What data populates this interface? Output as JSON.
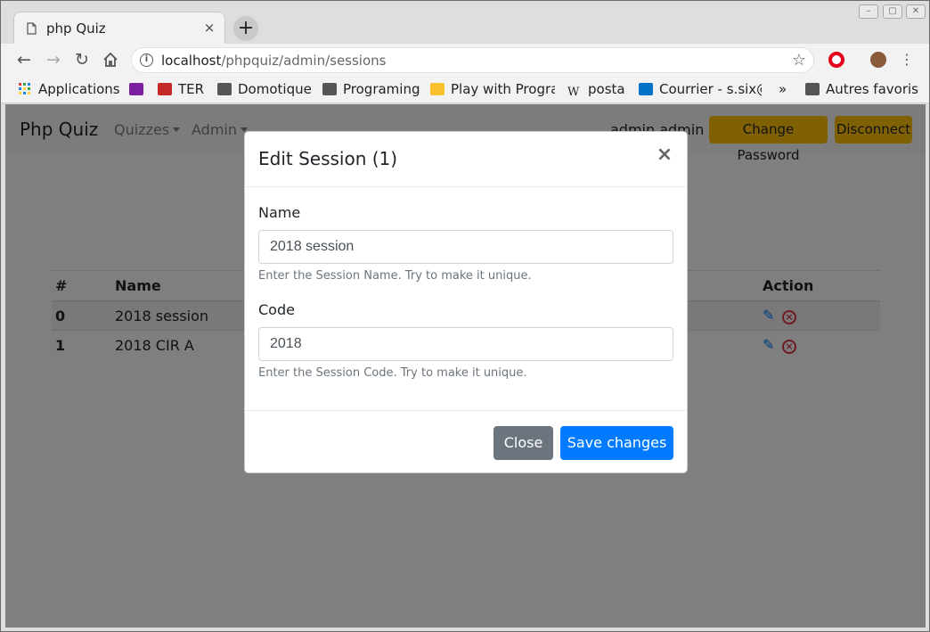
{
  "browser": {
    "tab_title": "php Quiz",
    "tab_close": "×",
    "new_tab": "+",
    "url_host": "localhost",
    "url_path": "/phpquiz/admin/sessions",
    "bookmarks": [
      "Applications",
      "TER",
      "Domotique",
      "Programing",
      "Play with Progra",
      "posta",
      "Courrier - s.six@",
      "Autres favoris"
    ],
    "overflow": "»"
  },
  "navbar": {
    "brand": "Php Quiz",
    "menu": [
      "Quizzes",
      "Admin"
    ],
    "user": "admin  admin",
    "change_password": "Change Password",
    "disconnect": "Disconnect"
  },
  "table": {
    "headers": [
      "#",
      "Name",
      "Action"
    ],
    "rows": [
      {
        "id": "0",
        "name": "2018 session"
      },
      {
        "id": "1",
        "name": "2018 CIR A"
      }
    ]
  },
  "modal": {
    "title": "Edit Session (1)",
    "close_symbol": "×",
    "name_label": "Name",
    "name_value": "2018 session",
    "name_help": "Enter the Session Name. Try to make it unique.",
    "code_label": "Code",
    "code_value": "2018",
    "code_help": "Enter the Session Code. Try to make it unique.",
    "close_button": "Close",
    "save_button": "Save changes"
  },
  "colors": {
    "primary": "#007bff",
    "secondary": "#6c757d",
    "warning": "#ffc107",
    "danger": "#dc3545"
  },
  "icons": [
    "page-icon",
    "back-arrow-icon",
    "forward-arrow-icon",
    "reload-icon",
    "home-icon",
    "info-icon",
    "star-icon",
    "opera-icon",
    "profile-icon",
    "menu-dots-icon",
    "apps-grid-icon",
    "folder-icon",
    "edit-icon",
    "delete-icon",
    "close-icon"
  ]
}
